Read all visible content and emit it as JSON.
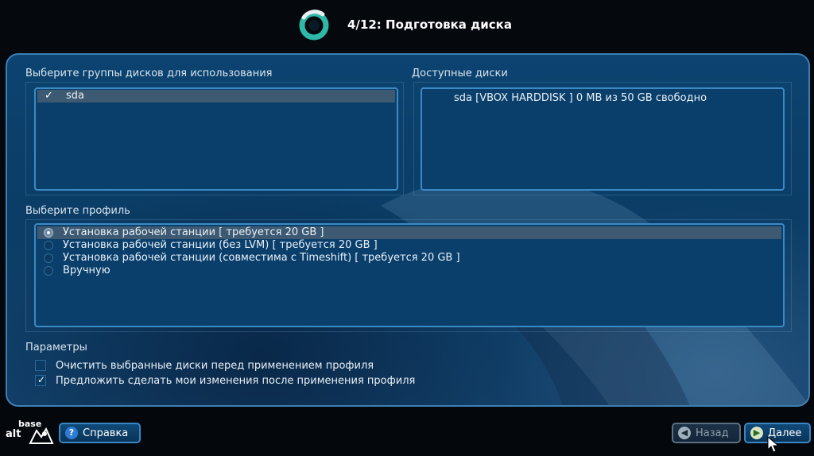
{
  "header": {
    "step_title": "4/12: Подготовка диска"
  },
  "disk_groups": {
    "label": "Выберите группы дисков для использования",
    "items": [
      {
        "label": "sda",
        "checked": true,
        "selected": true
      }
    ]
  },
  "available_disks": {
    "label": "Доступные диски",
    "items": [
      {
        "label": "sda [VBOX HARDDISK   ] 0 MB из 50 GB свободно"
      }
    ]
  },
  "profile": {
    "label": "Выберите профиль",
    "options": [
      {
        "label": "Установка рабочей станции [ требуется 20 GB ]",
        "selected": true
      },
      {
        "label": "Установка рабочей станции (без LVM) [ требуется 20 GB ]",
        "selected": false
      },
      {
        "label": "Установка рабочей станции (совместима с Timeshift) [ требуется 20 GB ]",
        "selected": false
      },
      {
        "label": "Вручную",
        "selected": false
      }
    ]
  },
  "parameters": {
    "label": "Параметры",
    "options": [
      {
        "label": "Очистить выбранные диски перед применением профиля",
        "checked": false
      },
      {
        "label": "Предложить сделать мои изменения после применения профиля",
        "checked": true
      }
    ]
  },
  "footer": {
    "brand_top": "base",
    "brand_bottom": "alt",
    "help_label": "Справка",
    "back_label": "Назад",
    "next_label": "Далее",
    "back_enabled": false
  },
  "icons": {
    "help": "question-icon",
    "back": "arrow-left-icon",
    "next": "arrow-right-icon",
    "check": "checkmark-icon"
  },
  "colors": {
    "panel_border": "#3d7fb3",
    "panel_bg": "#0b3d66",
    "accent": "#3a86c2",
    "logo_teal": "#2fb8a8"
  }
}
